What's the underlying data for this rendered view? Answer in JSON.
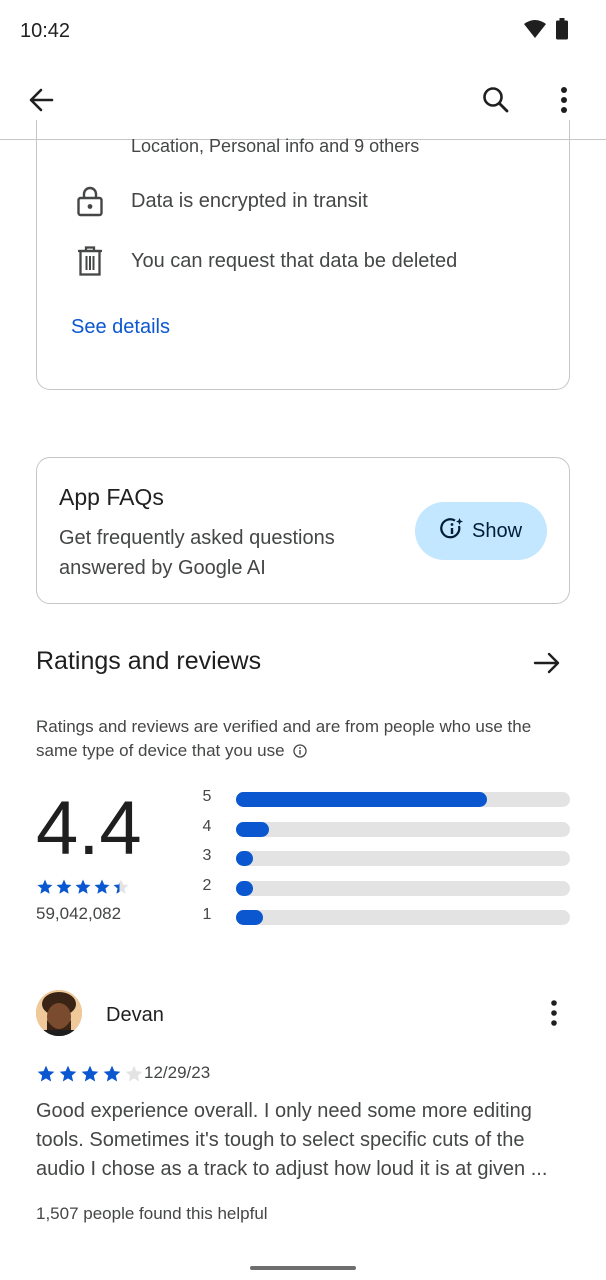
{
  "status": {
    "time": "10:42",
    "icons": [
      "wifi-icon",
      "battery-icon"
    ]
  },
  "app_bar": {
    "icons": [
      "back-arrow-icon",
      "search-icon",
      "more-vert-icon"
    ]
  },
  "data_safety": {
    "top_line": "Location, Personal info and 9 others",
    "items": [
      {
        "icon": "lock-icon",
        "text": "Data is encrypted in transit"
      },
      {
        "icon": "trash-icon",
        "text": "You can request that data be deleted"
      }
    ],
    "link": "See details"
  },
  "faq": {
    "title": "App FAQs",
    "description": "Get frequently asked questions answered by Google AI",
    "button": "Show"
  },
  "ratings": {
    "title": "Ratings and reviews",
    "note": "Ratings and reviews are verified and are from people who use the same type of device that you use",
    "score": "4.4",
    "stars": 4.4,
    "count": "59,042,082",
    "distribution": [
      {
        "label": "5",
        "fraction": 0.75
      },
      {
        "label": "4",
        "fraction": 0.1
      },
      {
        "label": "3",
        "fraction": 0.05
      },
      {
        "label": "2",
        "fraction": 0.05
      },
      {
        "label": "1",
        "fraction": 0.08
      }
    ]
  },
  "review": {
    "name": "Devan",
    "stars": 4,
    "date": "12/29/23",
    "text": "Good experience overall. I only need some more editing tools. Sometimes it's tough to select specific cuts of the audio I chose as a track to adjust how loud it is at given ...",
    "helpful": "1,507 people found this helpful"
  },
  "colors": {
    "accent": "#0b57d0",
    "chip": "#c2e7ff",
    "track": "#e3e3e3"
  }
}
